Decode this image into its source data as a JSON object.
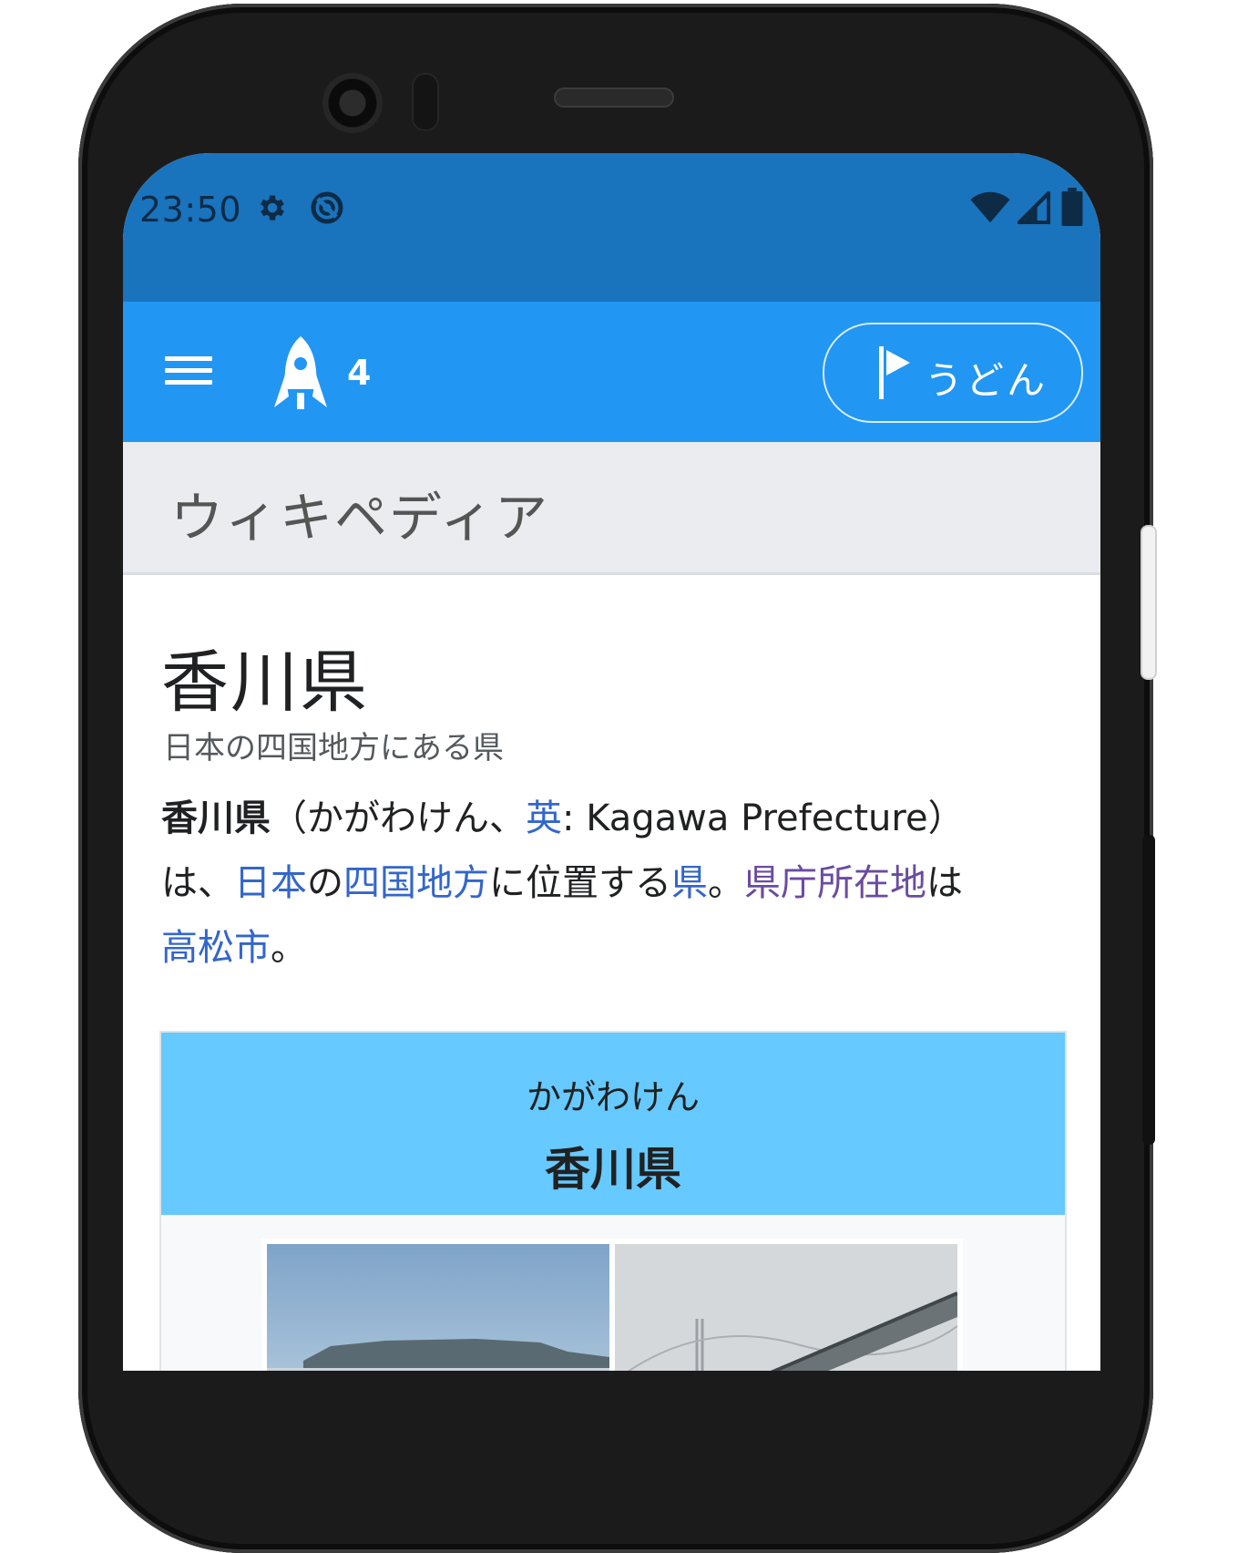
{
  "status_bar": {
    "time": "23:50",
    "icons": [
      "gear-icon",
      "data-saver-icon",
      "wifi-icon",
      "cell-signal-icon",
      "battery-icon"
    ]
  },
  "toolbar": {
    "tabs_count": "4",
    "project_label": "うどん",
    "colors": {
      "toolbar": "#2196f3",
      "status_bar": "#1a73bd"
    }
  },
  "wiki_header": {
    "logo_text": "ウィキペディア"
  },
  "article": {
    "title": "香川県",
    "description": "日本の四国地方にある県",
    "lead": {
      "bold_title": "香川県",
      "reading_open": "（かがわけん、",
      "link_en": "英",
      "en_name": ": Kagawa Prefecture）",
      "wa": "は、",
      "link_japan": "日本",
      "no": "の",
      "link_shikoku": "四国地方",
      "located": "に位置する",
      "link_prefecture": "県",
      "period1": "。",
      "link_capital": "県庁所在地",
      "wa2": "は",
      "link_takamatsu": "高松市",
      "period2": "。"
    }
  },
  "infobox": {
    "reading": "かがわけん",
    "name": "香川県",
    "header_color": "#66c9ff"
  }
}
